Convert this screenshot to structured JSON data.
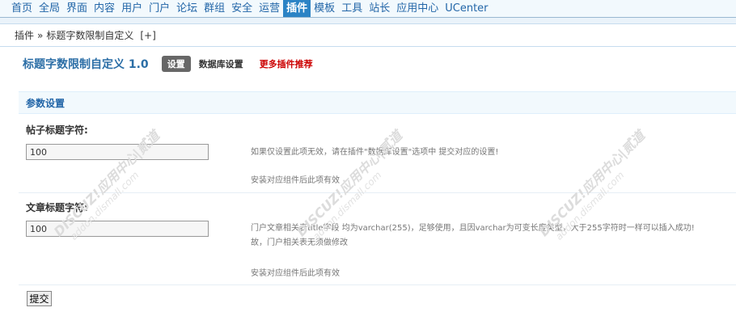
{
  "topnav": {
    "items": [
      {
        "label": "首页",
        "active": false
      },
      {
        "label": "全局",
        "active": false
      },
      {
        "label": "界面",
        "active": false
      },
      {
        "label": "内容",
        "active": false
      },
      {
        "label": "用户",
        "active": false
      },
      {
        "label": "门户",
        "active": false
      },
      {
        "label": "论坛",
        "active": false
      },
      {
        "label": "群组",
        "active": false
      },
      {
        "label": "安全",
        "active": false
      },
      {
        "label": "运营",
        "active": false
      },
      {
        "label": "插件",
        "active": true
      },
      {
        "label": "模板",
        "active": false
      },
      {
        "label": "工具",
        "active": false
      },
      {
        "label": "站长",
        "active": false
      },
      {
        "label": "应用中心",
        "active": false
      },
      {
        "label": "UCenter",
        "active": false
      }
    ]
  },
  "breadcrumb": {
    "root": "插件",
    "separator": "»",
    "current": "标题字数限制自定义",
    "add": "[+]"
  },
  "plugin": {
    "title": "标题字数限制自定义 1.0",
    "tab_current": "设置",
    "tab_db": "数据库设置",
    "tab_more": "更多插件推荐"
  },
  "section": {
    "title": "参数设置"
  },
  "settings": [
    {
      "label": "帖子标题字符:",
      "value": "100",
      "tip1": "如果仅设置此项无效，请在插件\"数据库设置\"选项中 提交对应的设置!",
      "tip2": "安装对应组件后此项有效"
    },
    {
      "label": "文章标题字符:",
      "value": "100",
      "tip1": "门户文章相关表title字段 均为varchar(255)，足够使用，且因varchar为可变长度类型，大于255字符时一样可以插入成功!",
      "tip1b": "故，门户相关表无须做修改",
      "tip2": "安装对应组件后此项有效"
    }
  ],
  "submit": {
    "label": "提交"
  },
  "watermark": {
    "brand": "DISCUZ!应用中心|贰道",
    "url": "addon.dismall.com"
  },
  "colors": {
    "nav_active": "#2b83c5",
    "link": "#2366a8",
    "more": "#cc0000"
  }
}
